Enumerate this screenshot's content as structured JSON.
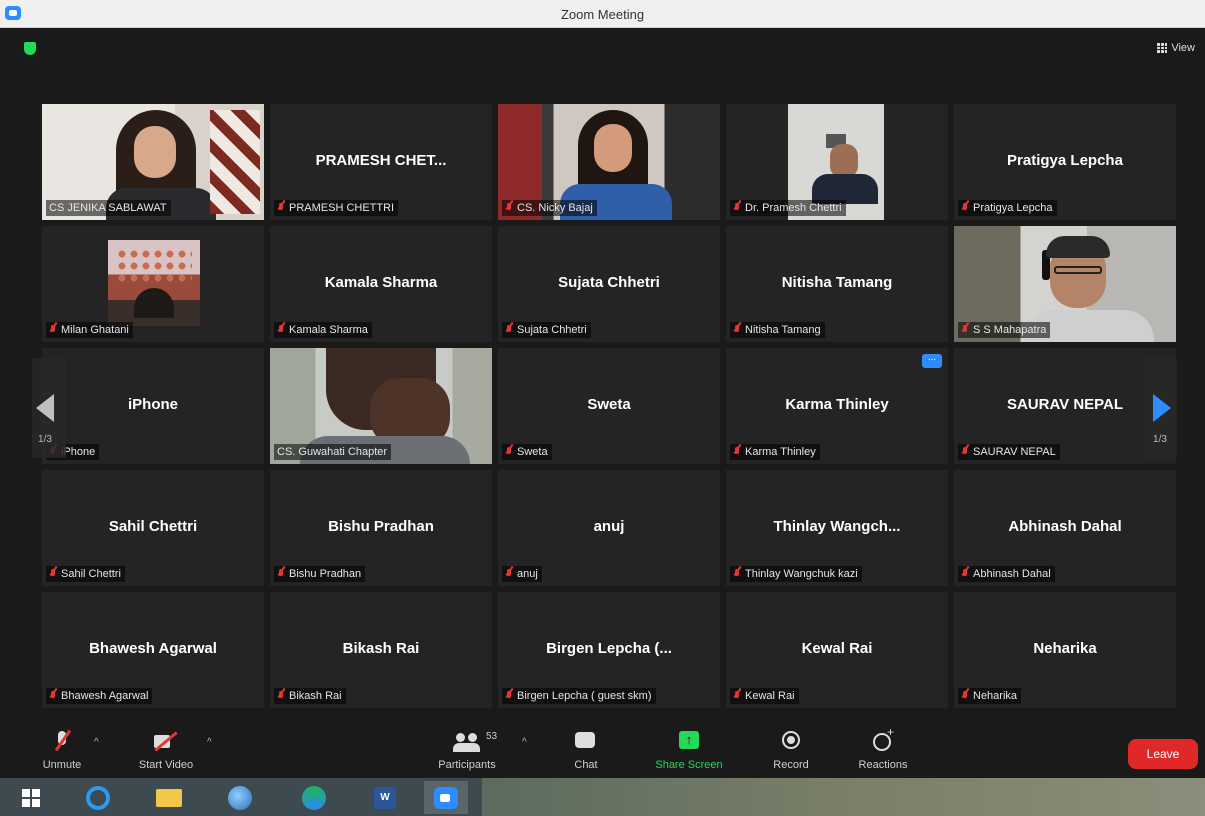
{
  "window": {
    "title": "Zoom Meeting"
  },
  "header": {
    "view_label": "View"
  },
  "tiles": [
    {
      "big": "",
      "label": "CS JENIKA SABLAWAT",
      "muted": false
    },
    {
      "big": "PRAMESH  CHET...",
      "label": "PRAMESH CHETTRI",
      "muted": true
    },
    {
      "big": "",
      "label": "CS. Nicky Bajaj",
      "muted": true
    },
    {
      "big": "",
      "label": "Dr. Pramesh Chettri",
      "muted": true
    },
    {
      "big": "Pratigya Lepcha",
      "label": "Pratigya Lepcha",
      "muted": true
    },
    {
      "big": "",
      "label": "Milan Ghatani",
      "muted": true
    },
    {
      "big": "Kamala Sharma",
      "label": "Kamala Sharma",
      "muted": true
    },
    {
      "big": "Sujata Chhetri",
      "label": "Sujata Chhetri",
      "muted": true
    },
    {
      "big": "Nitisha Tamang",
      "label": "Nitisha Tamang",
      "muted": true
    },
    {
      "big": "",
      "label": "S S Mahapatra",
      "muted": true
    },
    {
      "big": "iPhone",
      "label": "iPhone",
      "muted": true
    },
    {
      "big": "",
      "label": "CS. Guwahati Chapter",
      "muted": false
    },
    {
      "big": "Sweta",
      "label": "Sweta",
      "muted": true
    },
    {
      "big": "Karma Thinley",
      "label": "Karma Thinley",
      "muted": true
    },
    {
      "big": "SAURAV NEPAL",
      "label": "SAURAV NEPAL",
      "muted": true
    },
    {
      "big": "Sahil Chettri",
      "label": "Sahil Chettri",
      "muted": true
    },
    {
      "big": "Bishu Pradhan",
      "label": "Bishu Pradhan",
      "muted": true
    },
    {
      "big": "anuj",
      "label": "anuj",
      "muted": true
    },
    {
      "big": "Thinlay  Wangch...",
      "label": "Thinlay Wangchuk kazi",
      "muted": true
    },
    {
      "big": "Abhinash Dahal",
      "label": "Abhinash Dahal",
      "muted": true
    },
    {
      "big": "Bhawesh Agarwal",
      "label": "Bhawesh Agarwal",
      "muted": true
    },
    {
      "big": "Bikash Rai",
      "label": "Bikash Rai",
      "muted": true
    },
    {
      "big": "Birgen  Lepcha  (...",
      "label": "Birgen Lepcha ( guest skm)",
      "muted": true
    },
    {
      "big": "Kewal Rai",
      "label": "Kewal Rai",
      "muted": true
    },
    {
      "big": "Neharika",
      "label": "Neharika",
      "muted": true
    }
  ],
  "pager": {
    "left": "1/3",
    "right": "1/3"
  },
  "more_label": "...",
  "toolbar": {
    "unmute": "Unmute",
    "start_video": "Start Video",
    "participants": "Participants",
    "participant_count": "53",
    "chat": "Chat",
    "share_screen": "Share Screen",
    "record": "Record",
    "reactions": "Reactions",
    "leave": "Leave",
    "caret": "^"
  },
  "taskbar": {
    "word_label": "W"
  },
  "colors": {
    "accent": "#2d8cff",
    "share": "#23d959",
    "leave": "#e02828",
    "active_speaker": "#d8e23a"
  }
}
